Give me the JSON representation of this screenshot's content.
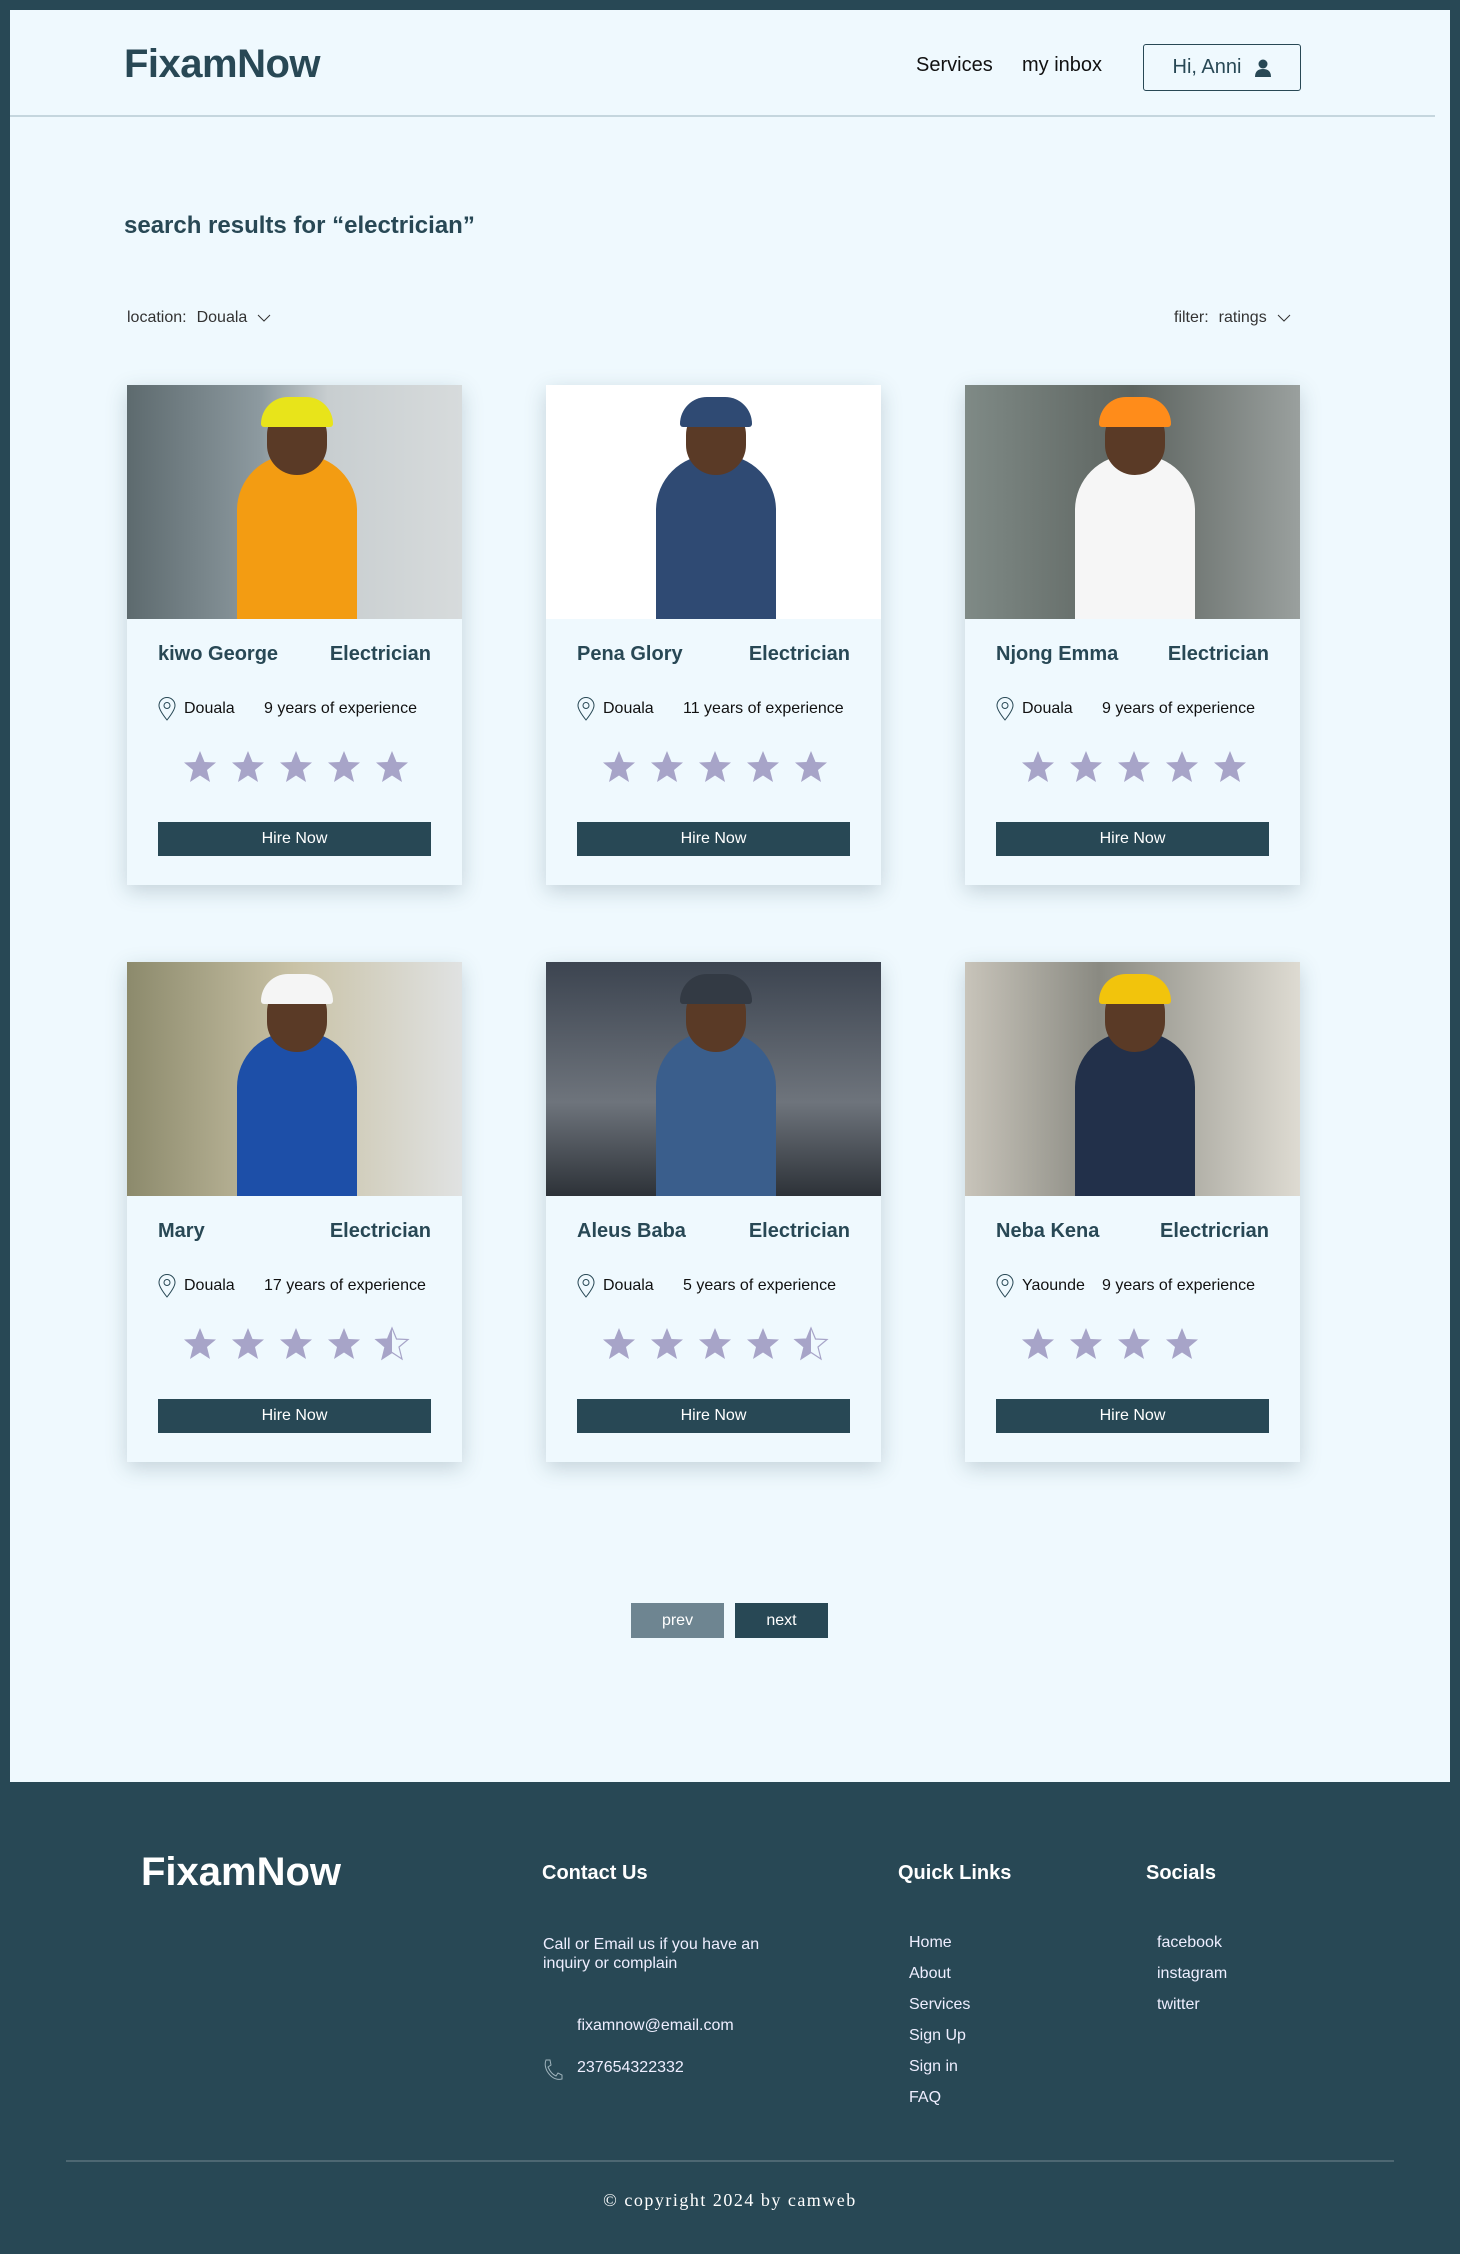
{
  "header": {
    "logo": "FixamNow",
    "nav": [
      "Services",
      "my inbox"
    ],
    "user_greeting": "Hi, Anni"
  },
  "search": {
    "title": "search results for “electrician”",
    "location_label": "location:",
    "location_value": "Douala",
    "filter_label": "filter:",
    "filter_value": "ratings"
  },
  "colors": {
    "primary": "#284855",
    "background": "#eff9fe",
    "star": "#a7a4c8"
  },
  "cards": [
    {
      "name": "kiwo George",
      "role": "Electrician",
      "location": "Douala",
      "experience": "9 years of experience",
      "rating": 5,
      "button": "Hire Now"
    },
    {
      "name": "Pena Glory",
      "role": "Electrician",
      "location": "Douala",
      "experience": "11 years of experience",
      "rating": 5,
      "button": "Hire Now"
    },
    {
      "name": "Njong Emma",
      "role": "Electrician",
      "location": "Douala",
      "experience": "9 years of experience",
      "rating": 5,
      "button": "Hire Now"
    },
    {
      "name": "Mary",
      "role": "Electrician",
      "location": "Douala",
      "experience": "17 years of experience",
      "rating": 4.5,
      "button": "Hire Now"
    },
    {
      "name": "Aleus Baba",
      "role": "Electrician",
      "location": "Douala",
      "experience": "5 years of experience",
      "rating": 4.5,
      "button": "Hire Now"
    },
    {
      "name": "Neba Kena",
      "role": "Electricrian",
      "location": "Yaounde",
      "experience": "9 years of experience",
      "rating": 4,
      "button": "Hire Now"
    }
  ],
  "pagination": {
    "prev": "prev",
    "next": "next"
  },
  "footer": {
    "logo": "FixamNow",
    "contact_title": "Contact Us",
    "contact_text": "Call or Email us if you have an inquiry or complain",
    "email": "fixamnow@email.com",
    "phone": "237654322332",
    "quick_title": "Quick Links",
    "quick_links": [
      "Home",
      "About",
      "Services",
      "Sign Up",
      "Sign in",
      "FAQ"
    ],
    "socials_title": "Socials",
    "socials": [
      "facebook",
      "instagram",
      "twitter"
    ],
    "copyright": "© copyright 2024 by camweb"
  }
}
